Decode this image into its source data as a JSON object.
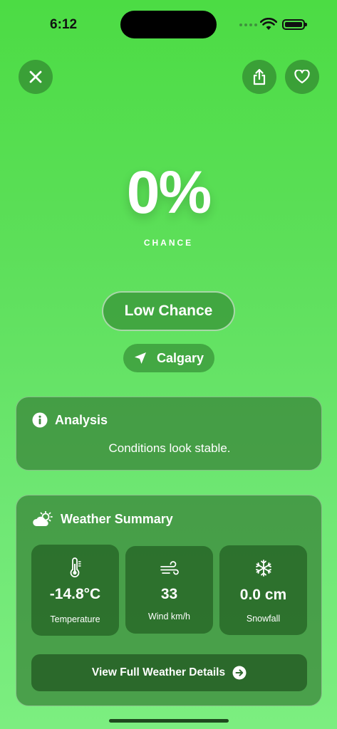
{
  "status_bar": {
    "time": "6:12"
  },
  "hero": {
    "percent": "0%",
    "label": "CHANCE"
  },
  "level_badge": "Low Chance",
  "location": "Calgary",
  "analysis": {
    "title": "Analysis",
    "text": "Conditions look stable."
  },
  "weather_summary": {
    "title": "Weather Summary",
    "tiles": [
      {
        "icon": "thermometer-icon",
        "value": "-14.8°C",
        "label": "Temperature"
      },
      {
        "icon": "wind-icon",
        "value": "33",
        "label": "Wind km/h"
      },
      {
        "icon": "snowflake-icon",
        "value": "0.0 cm",
        "label": "Snowfall"
      }
    ],
    "details_button": "View Full Weather Details"
  }
}
